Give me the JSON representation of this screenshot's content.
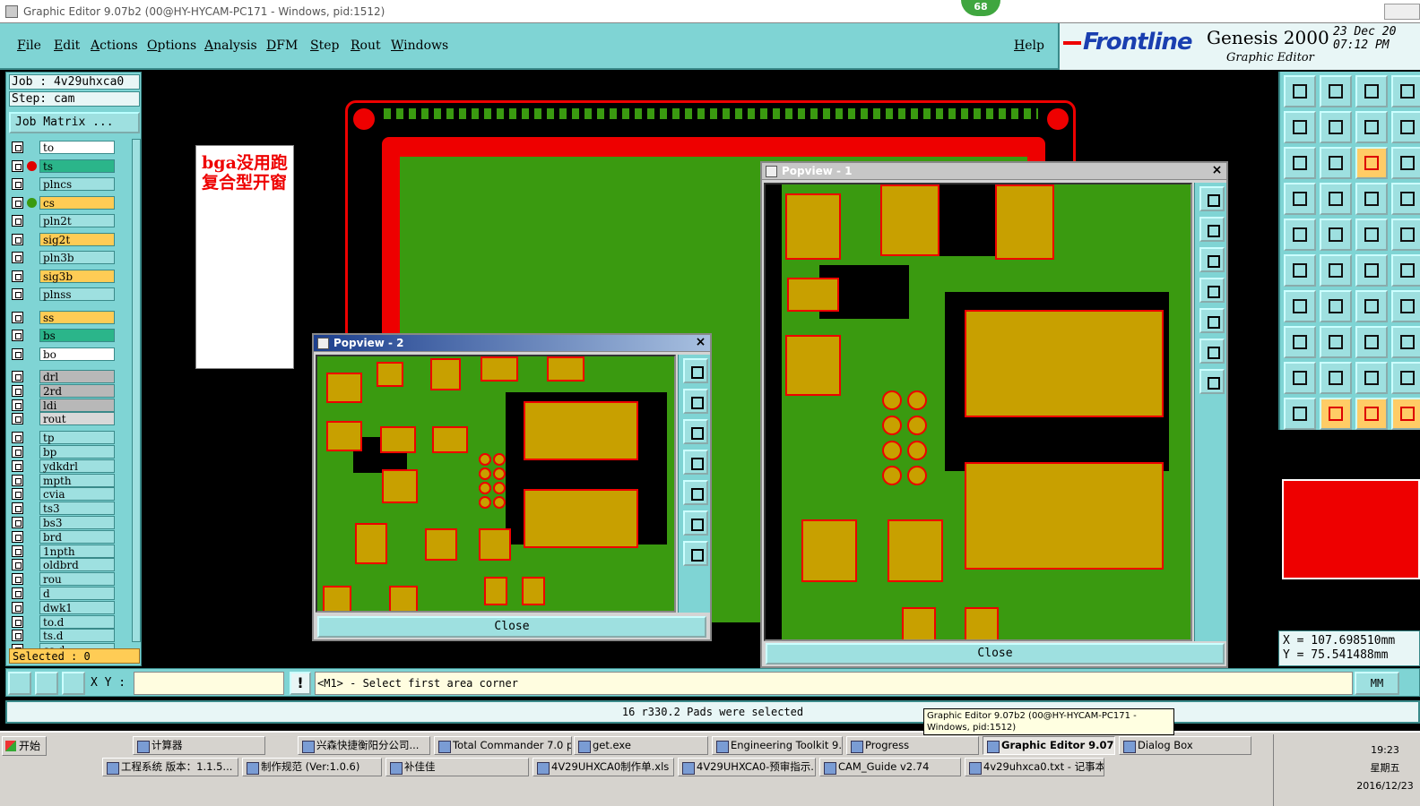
{
  "window": {
    "title": "Graphic Editor 9.07b2 (00@HY-HYCAM-PC171 - Windows, pid:1512)",
    "badge": "68"
  },
  "menu": [
    "File",
    "Edit",
    "Actions",
    "Options",
    "Analysis",
    "DFM",
    "Step",
    "Rout",
    "Windows"
  ],
  "help": "Help",
  "brand": {
    "logo": "Frontline",
    "product": "Genesis 2000",
    "subtitle": "Graphic Editor",
    "date": "23 Dec 20\n07:12 PM"
  },
  "job": {
    "job_label": "Job : 4v29uhxca0",
    "step_label": "Step: cam",
    "matrix_button": "Job Matrix ..."
  },
  "layers": [
    {
      "name": "to",
      "color": "#ffffff",
      "dot": ""
    },
    {
      "name": "ts",
      "color": "#2bb58a",
      "dot": "#e00000"
    },
    {
      "name": "plncs",
      "color": "#9ee0e0",
      "dot": ""
    },
    {
      "name": "cs",
      "color": "#ffcc55",
      "dot": "#3a9a10"
    },
    {
      "name": "pln2t",
      "color": "#9ee0e0",
      "dot": ""
    },
    {
      "name": "sig2t",
      "color": "#ffcc55",
      "dot": ""
    },
    {
      "name": "pln3b",
      "color": "#9ee0e0",
      "dot": ""
    },
    {
      "name": "sig3b",
      "color": "#ffcc55",
      "dot": ""
    },
    {
      "name": "plnss",
      "color": "#9ee0e0",
      "dot": ""
    },
    {
      "name": "ss",
      "color": "#ffcc55",
      "dot": ""
    },
    {
      "name": "bs",
      "color": "#2bb58a",
      "dot": ""
    },
    {
      "name": "bo",
      "color": "#ffffff",
      "dot": ""
    },
    {
      "name": "drl",
      "color": "#b8b8b8",
      "dot": ""
    },
    {
      "name": "2rd",
      "color": "#b8b8b8",
      "dot": ""
    },
    {
      "name": "ldi",
      "color": "#b8b8b8",
      "dot": ""
    },
    {
      "name": "rout",
      "color": "#d8d8d8",
      "dot": ""
    },
    {
      "name": "tp",
      "color": "#9ee0e0",
      "dot": ""
    },
    {
      "name": "bp",
      "color": "#9ee0e0",
      "dot": ""
    },
    {
      "name": "ydkdrl",
      "color": "#9ee0e0",
      "dot": ""
    },
    {
      "name": "mpth",
      "color": "#9ee0e0",
      "dot": ""
    },
    {
      "name": "cvia",
      "color": "#9ee0e0",
      "dot": ""
    },
    {
      "name": "ts3",
      "color": "#9ee0e0",
      "dot": ""
    },
    {
      "name": "bs3",
      "color": "#9ee0e0",
      "dot": ""
    },
    {
      "name": "brd",
      "color": "#9ee0e0",
      "dot": ""
    },
    {
      "name": "1npth",
      "color": "#9ee0e0",
      "dot": ""
    },
    {
      "name": "oldbrd",
      "color": "#9ee0e0",
      "dot": ""
    },
    {
      "name": "rou",
      "color": "#9ee0e0",
      "dot": ""
    },
    {
      "name": "d",
      "color": "#9ee0e0",
      "dot": ""
    },
    {
      "name": "dwk1",
      "color": "#9ee0e0",
      "dot": ""
    },
    {
      "name": "to.d",
      "color": "#9ee0e0",
      "dot": ""
    },
    {
      "name": "ts.d",
      "color": "#9ee0e0",
      "dot": ""
    },
    {
      "name": "cs.d",
      "color": "#9ee0e0",
      "dot": ""
    }
  ],
  "selected": "Selected : 0",
  "note": "bga没用跑复合型开窗",
  "popview1": {
    "title": "Popview - 1",
    "close": "Close"
  },
  "popview2": {
    "title": "Popview - 2",
    "close": "Close"
  },
  "coords": "X = 107.698510mm\nY = 75.541488mm",
  "cmd": {
    "xy_label": "X Y :",
    "xy_value": "",
    "prompt": "<M1> - Select first area corner",
    "units": "MM",
    "bang": "!"
  },
  "status": "16 r330.2 Pads were selected",
  "tooltip": "Graphic Editor 9.07b2 (00@HY-HYCAM-PC171 - Windows, pid:1512)",
  "taskbar": {
    "start": "开始",
    "row1": [
      "计算器",
      "兴森快捷衡阳分公司...",
      "Total Commander 7.0 p...",
      "get.exe",
      "Engineering Toolkit 9.0...",
      "Progress",
      "Graphic Editor 9.07b...",
      "Dialog Box"
    ],
    "row2": [
      "工程系统  版本：1.1.5...",
      "制作规范 (Ver:1.0.6)",
      "补佳佳",
      "4V29UHXCA0制作单.xls ...",
      "4V29UHXCA0-预审指示...",
      "CAM_Guide v2.74",
      "4v29uhxca0.txt - 记事本"
    ],
    "active_item": "Graphic Editor 9.07b...",
    "time": "19:23",
    "weekday": "星期五",
    "date": "2016/12/23"
  }
}
